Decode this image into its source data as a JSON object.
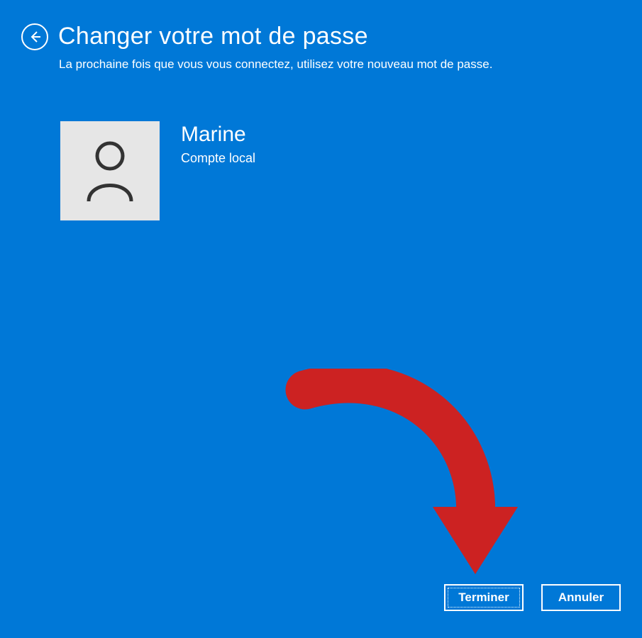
{
  "header": {
    "title": "Changer votre mot de passe",
    "subtitle": "La prochaine fois que vous vous connectez, utilisez votre nouveau mot de passe."
  },
  "account": {
    "name": "Marine",
    "type": "Compte local"
  },
  "buttons": {
    "primary": "Terminer",
    "secondary": "Annuler"
  }
}
